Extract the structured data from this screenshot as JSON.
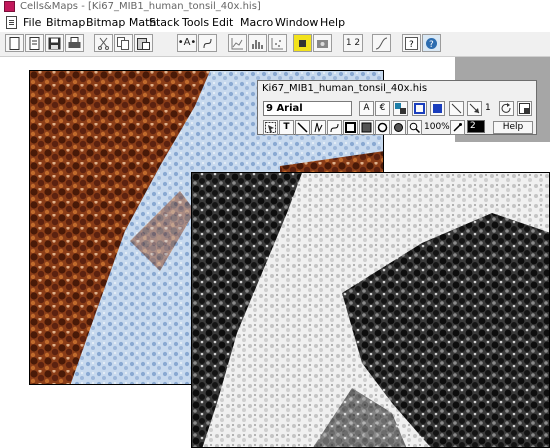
{
  "window": {
    "title": "Cells&Maps - [Ki67_MIB1_human_tonsil_40x.his]",
    "app_icon": "app-logo-icon"
  },
  "menu": {
    "items": [
      "File",
      "Bitmap",
      "Bitmap Math",
      "Stack",
      "Tools",
      "Edit",
      "Macro",
      "Window",
      "Help"
    ]
  },
  "toolbar": {
    "labels": {
      "text_tool": "•A•",
      "zoom_ratio": "1 2"
    },
    "icons": [
      "new-doc-icon",
      "open-doc-icon",
      "save-icon",
      "print-icon",
      "cut-icon",
      "copy-icon",
      "paste-icon",
      "text-tool-icon",
      "curve-tool-icon",
      "chart-icon",
      "histogram-icon",
      "map-icon",
      "color-icon",
      "camera-icon",
      "page-icon",
      "zoom-ratio-icon",
      "curve-icon",
      "help-index-icon",
      "about-icon"
    ]
  },
  "palette": {
    "title": "Ki67_MIB1_human_tonsil_40x.his",
    "font_value": "9 Arial",
    "line_width": "1",
    "zoom": "100%",
    "color_value": "2",
    "help_label": "Help",
    "font_buttons": [
      "A",
      "€"
    ],
    "icons": [
      "font-size-icon",
      "currency-icon",
      "color-swatch-icon",
      "rectangle-outline-icon",
      "rectangle-fill-icon",
      "line-icon",
      "arrow-icon",
      "rotate-icon",
      "export-icon",
      "select-tool-icon",
      "text-tool-icon",
      "line-tool-icon",
      "freehand-tool-icon",
      "bezier-tool-icon",
      "rect-tool-icon",
      "rect-fill-tool-icon",
      "ellipse-tool-icon",
      "ellipse-fill-tool-icon",
      "zoom-tool-icon",
      "eyedropper-icon"
    ]
  },
  "images": {
    "original": "Ki67 stained tonsil tissue",
    "grayscale": "grayscale conversion"
  },
  "colors": {
    "stain_brown": "#6b2a10",
    "counterstain_blue": "#b7cde6",
    "accent_yellow": "#f2e21c",
    "workspace_gray": "#a6a6a6"
  }
}
